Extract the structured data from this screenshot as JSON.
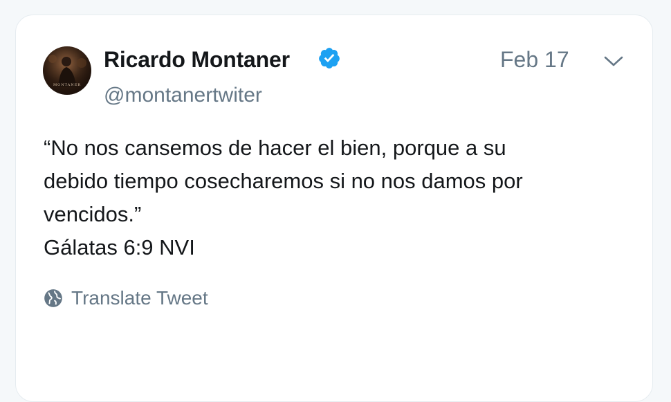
{
  "tweet": {
    "author_name": "Ricardo Montaner",
    "verified_icon": "verified-badge-icon",
    "handle": "@montanertwiter",
    "date": "Feb 17",
    "text": "“No nos cansemos de hacer el bien, porque a su\ndebido tiempo cosecharemos si no nos damos por\nvencidos.”\nGálatas 6:9 NVI",
    "avatar_caption": "MONTANER",
    "translate_label": "Translate Tweet",
    "more_icon": "chevron-down-icon",
    "translate_icon": "globe-icon"
  },
  "colors": {
    "background": "#f5f8fa",
    "card": "#ffffff",
    "text": "#14171a",
    "secondary": "#657786",
    "verified": "#1da1f2"
  }
}
